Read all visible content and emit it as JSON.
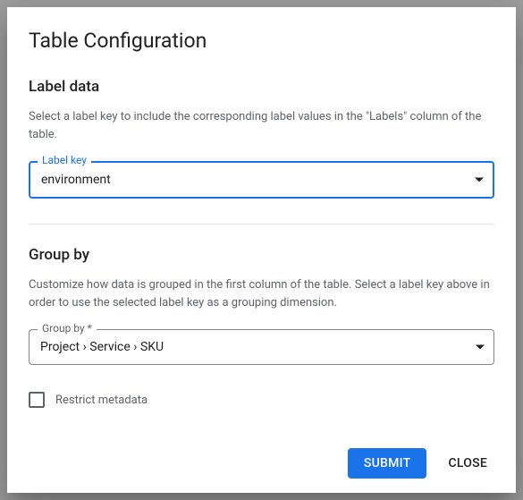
{
  "dialog": {
    "title": "Table Configuration"
  },
  "label_data": {
    "heading": "Label data",
    "description": "Select a label key to include the corresponding label values in the \"Labels\" column of the table.",
    "field_label": "Label key",
    "value": "environment"
  },
  "group_by": {
    "heading": "Group by",
    "description": "Customize how data is grouped in the first column of the table. Select a label key above in order to use the selected label key as a grouping dimension.",
    "field_label": "Group by *",
    "value": "Project › Service › SKU"
  },
  "restrict_metadata": {
    "label": "Restrict metadata",
    "checked": false
  },
  "actions": {
    "submit": "SUBMIT",
    "close": "CLOSE"
  },
  "colors": {
    "primary": "#1a73e8",
    "text": "#202124",
    "secondary_text": "#5f6368",
    "border_neutral": "#80868b",
    "divider": "#e8eaed"
  }
}
